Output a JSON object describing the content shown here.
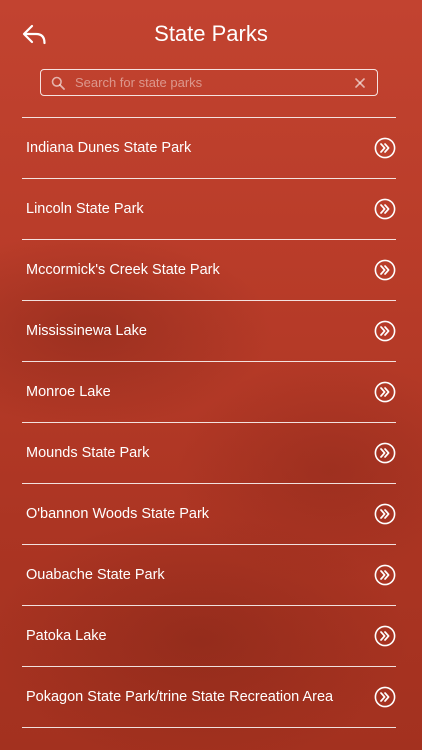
{
  "header": {
    "title": "State Parks",
    "back_icon": "back-arrow-icon"
  },
  "search": {
    "placeholder": "Search for state parks",
    "value": "",
    "icon": "search-icon",
    "clear_icon": "close-icon"
  },
  "colors": {
    "background": "#b93c29",
    "text": "#ffffff",
    "divider": "#ffffff"
  },
  "parks": [
    {
      "label": "Indiana Dunes State Park"
    },
    {
      "label": "Lincoln State Park"
    },
    {
      "label": "Mccormick's Creek State Park"
    },
    {
      "label": "Mississinewa Lake"
    },
    {
      "label": "Monroe Lake"
    },
    {
      "label": "Mounds State Park"
    },
    {
      "label": "O'bannon Woods State Park"
    },
    {
      "label": "Ouabache State Park"
    },
    {
      "label": "Patoka Lake"
    },
    {
      "label": "Pokagon State Park/trine State Recreation Area"
    }
  ],
  "row_icon": "double-chevron-right-icon"
}
